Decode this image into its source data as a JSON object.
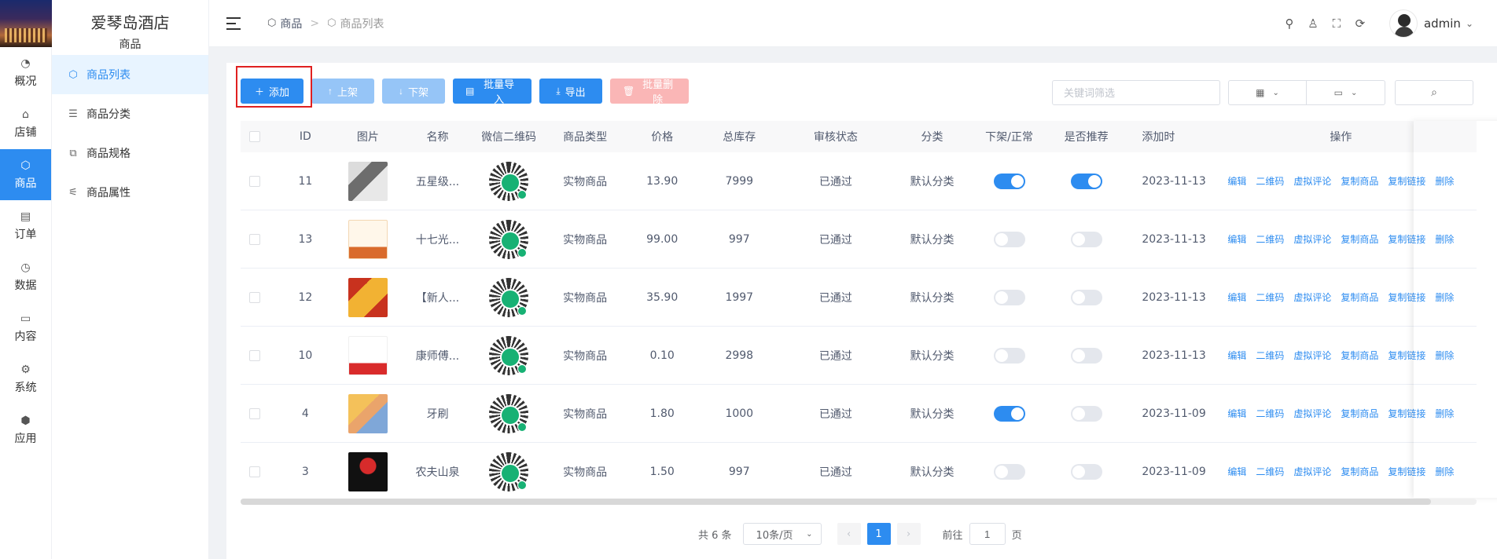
{
  "rail": {
    "items": [
      {
        "icon": "gauge-icon",
        "glyph": "◔",
        "label": "概况"
      },
      {
        "icon": "store-icon",
        "glyph": "⌂",
        "label": "店铺"
      },
      {
        "icon": "cube-icon",
        "glyph": "⬡",
        "label": "商品"
      },
      {
        "icon": "clipboard-icon",
        "glyph": "▤",
        "label": "订单"
      },
      {
        "icon": "pie-chart-icon",
        "glyph": "◷",
        "label": "数据"
      },
      {
        "icon": "folder-icon",
        "glyph": "▭",
        "label": "内容"
      },
      {
        "icon": "gear-icon",
        "glyph": "⚙",
        "label": "系统"
      },
      {
        "icon": "package-icon",
        "glyph": "⬢",
        "label": "应用"
      }
    ],
    "active_index": 2
  },
  "submenu": {
    "store_name": "爱琴岛酒店",
    "section": "商品",
    "items": [
      {
        "label": "商品列表",
        "glyph": "⬡"
      },
      {
        "label": "商品分类",
        "glyph": "☰"
      },
      {
        "label": "商品规格",
        "glyph": "⧉"
      },
      {
        "label": "商品属性",
        "glyph": "⚟"
      }
    ]
  },
  "header": {
    "breadcrumb": {
      "parent": "商品",
      "separator": ">",
      "current": "商品列表"
    },
    "username": "admin"
  },
  "toolbar": {
    "add": "添加",
    "on_shelf": "上架",
    "off_shelf": "下架",
    "batch_import": "批量导入",
    "export": "导出",
    "batch_delete": "批量删除"
  },
  "filters": {
    "keyword_placeholder": "关键词筛选"
  },
  "table": {
    "headers": {
      "id": "ID",
      "image": "图片",
      "name": "名称",
      "qr": "微信二维码",
      "type": "商品类型",
      "price": "价格",
      "stock": "总库存",
      "audit": "审核状态",
      "category": "分类",
      "onoff": "下架/正常",
      "recommend": "是否推荐",
      "added": "添加时",
      "ops": "操作"
    },
    "ops": {
      "edit": "编辑",
      "qrcode": "二维码",
      "fake_review": "虚拟评论",
      "copy_product": "复制商品",
      "copy_link": "复制链接",
      "delete": "删除"
    },
    "rows": [
      {
        "id": "11",
        "name": "五星级...",
        "type": "实物商品",
        "price": "13.90",
        "stock": "7999",
        "audit": "已通过",
        "category": "默认分类",
        "on": true,
        "rec": true,
        "date": "2023-11-13"
      },
      {
        "id": "13",
        "name": "十七光...",
        "type": "实物商品",
        "price": "99.00",
        "stock": "997",
        "audit": "已通过",
        "category": "默认分类",
        "on": false,
        "rec": false,
        "date": "2023-11-13"
      },
      {
        "id": "12",
        "name": "【新人...",
        "type": "实物商品",
        "price": "35.90",
        "stock": "1997",
        "audit": "已通过",
        "category": "默认分类",
        "on": false,
        "rec": false,
        "date": "2023-11-13"
      },
      {
        "id": "10",
        "name": "康师傅...",
        "type": "实物商品",
        "price": "0.10",
        "stock": "2998",
        "audit": "已通过",
        "category": "默认分类",
        "on": false,
        "rec": false,
        "date": "2023-11-13"
      },
      {
        "id": "4",
        "name": "牙刷",
        "type": "实物商品",
        "price": "1.80",
        "stock": "1000",
        "audit": "已通过",
        "category": "默认分类",
        "on": true,
        "rec": false,
        "date": "2023-11-09"
      },
      {
        "id": "3",
        "name": "农夫山泉",
        "type": "实物商品",
        "price": "1.50",
        "stock": "997",
        "audit": "已通过",
        "category": "默认分类",
        "on": false,
        "rec": false,
        "date": "2023-11-09"
      }
    ]
  },
  "pagination": {
    "total": "共 6 条",
    "page_size": "10条/页",
    "current_page": "1",
    "goto_prefix": "前往",
    "goto_value": "1",
    "goto_suffix": "页"
  }
}
